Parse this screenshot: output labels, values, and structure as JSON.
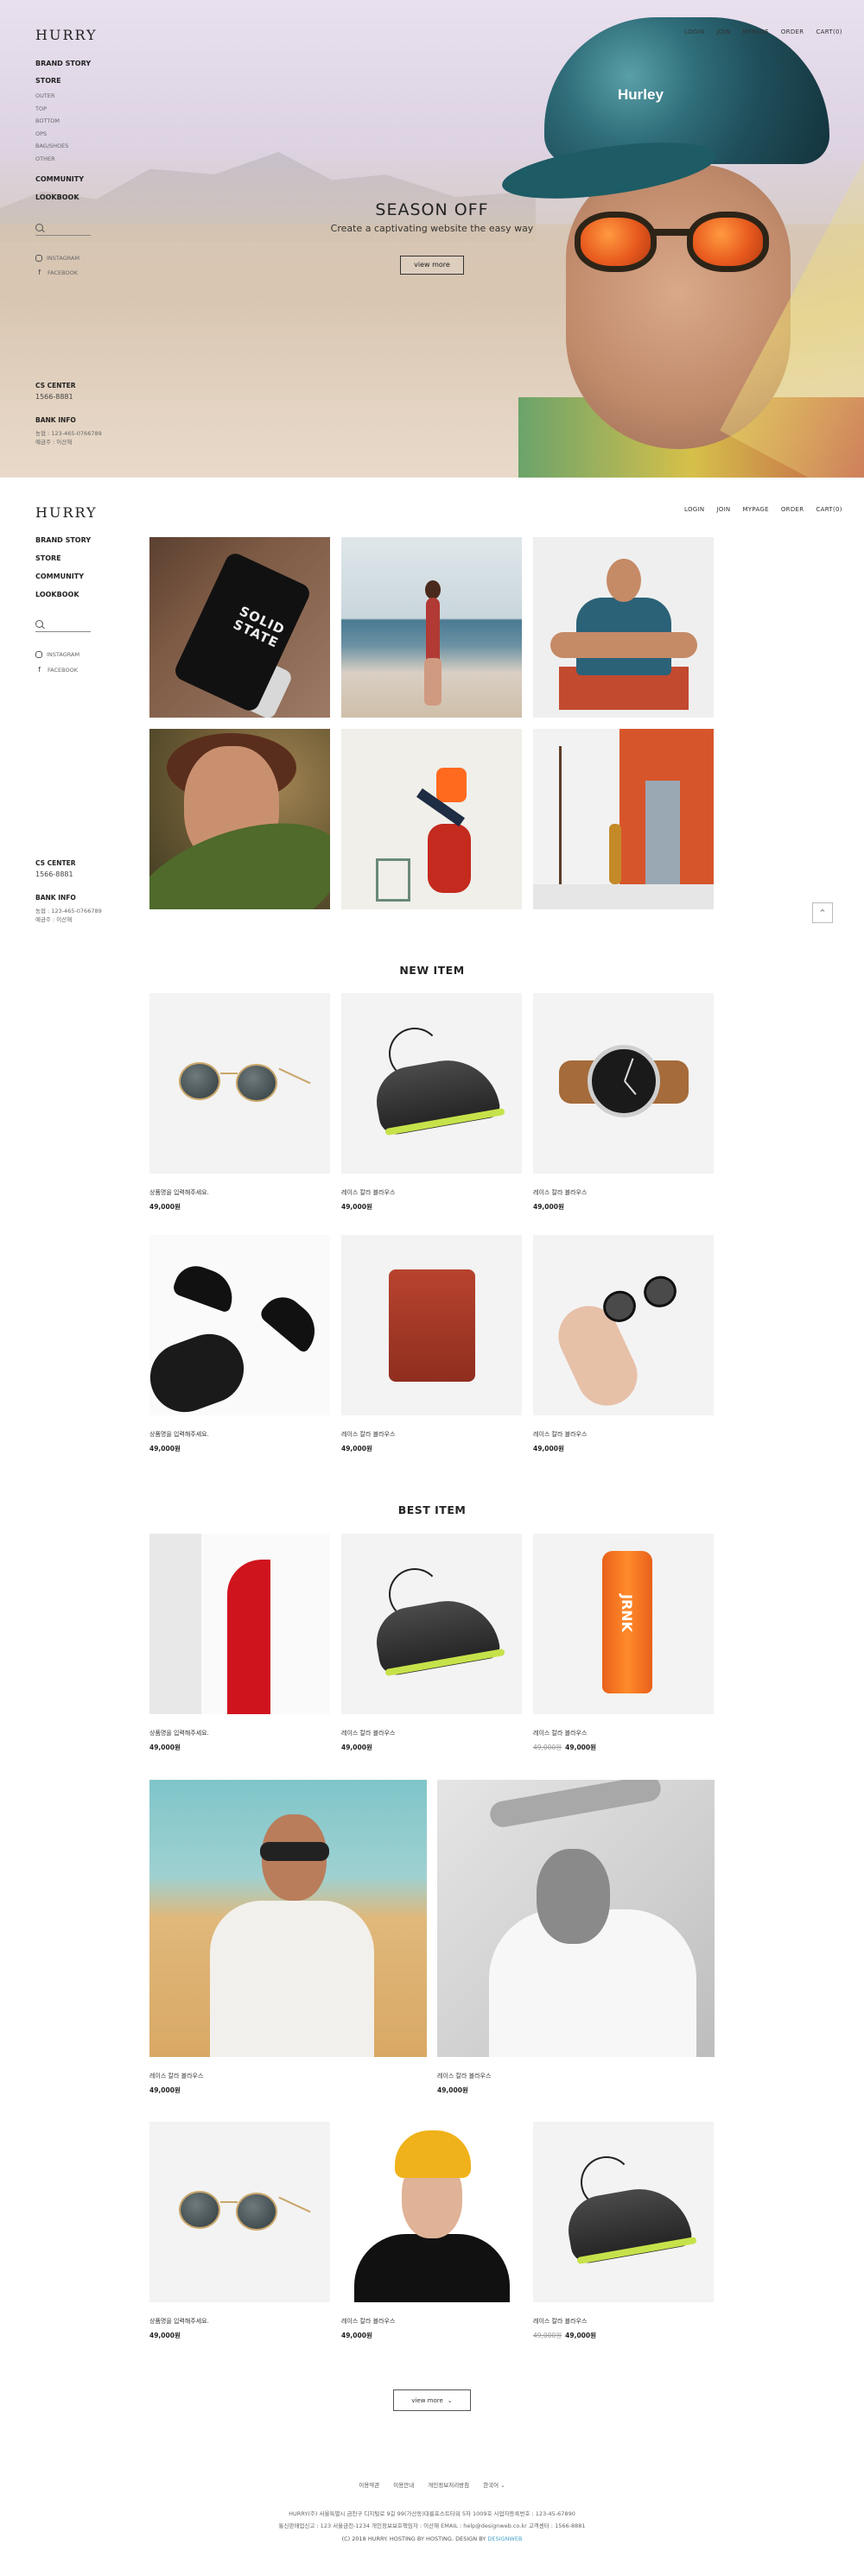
{
  "brand": "HURRY",
  "topnav": [
    "LOGIN",
    "JOIN",
    "MYPAGE",
    "ORDER",
    "CART(0)"
  ],
  "sidebar": {
    "main_items": [
      "BRAND STORY",
      "STORE",
      "COMMUNITY",
      "LOOKBOOK"
    ],
    "store_sub": [
      "OUTER",
      "TOP",
      "BOTTOM",
      "OPS",
      "BAG/SHOES",
      "OTHER"
    ],
    "social": [
      "INSTAGRAM",
      "FACEBOOK"
    ],
    "cs_title": "CS CENTER",
    "cs_phone": "1566-8881",
    "bank_title": "BANK INFO",
    "bank_lines": [
      "농협 : 123-465-0766789",
      "예금주 : 이산해"
    ]
  },
  "hero": {
    "title": "SEASON OFF",
    "subtitle": "Create a captivating website the easy way",
    "button": "view more",
    "hat_logo": "Hurley"
  },
  "gallery": {
    "phone_text": "SOLID STATE"
  },
  "new_item": {
    "title": "NEW ITEM",
    "products": [
      {
        "name": "상품명을 입력해주세요.",
        "price": "49,000원"
      },
      {
        "name": "레이스 칼라 블라우스",
        "price": "49,000원"
      },
      {
        "name": "레이스 칼라 블라우스",
        "price": "49,000원"
      },
      {
        "name": "상품명을 입력해주세요.",
        "price": "49,000원"
      },
      {
        "name": "레이스 칼라 블라우스",
        "price": "49,000원"
      },
      {
        "name": "레이스 칼라 블라우스",
        "price": "49,000원"
      }
    ]
  },
  "best_item": {
    "title": "BEST ITEM",
    "products": [
      {
        "name": "상품명을 입력해주세요.",
        "price": "49,000원"
      },
      {
        "name": "레이스 칼라 블라우스",
        "price": "49,000원"
      },
      {
        "name": "레이스 칼라 블라우스",
        "old_price": "49,000원",
        "price": "49,000원"
      }
    ],
    "large": [
      {
        "name": "레이스 칼라 블라우스",
        "price": "49,000원"
      },
      {
        "name": "레이스 칼라 블라우스",
        "price": "49,000원"
      }
    ],
    "products2": [
      {
        "name": "상품명을 입력해주세요.",
        "price": "49,000원"
      },
      {
        "name": "레이스 칼라 블라우스",
        "price": "49,000원"
      },
      {
        "name": "레이스 칼라 블라우스",
        "old_price": "49,000원",
        "price": "49,000원"
      }
    ],
    "jar_text": "JRNK"
  },
  "view_more": "view more",
  "footer": {
    "links": [
      "이용약관",
      "이용안내",
      "개인정보처리방침",
      "한국어"
    ],
    "info1": "HURRY(주)    서울특별시 금천구 디지털로 9길 99(가산동)대륭포스트타워 5차 1009호    사업자등록번호 : 123-45-67890",
    "info2": "통신판매업신고 : 123 서울금천-1234    개인정보보호책임자 : 이산해    EMAIL : help@designweb.co.kr    고객센터 : 1566-8881",
    "copyright": "(C) 2018 HURRY. HOSTING BY HOSTING. DESIGN BY",
    "designer": "DESIGNWEB"
  },
  "colors": {
    "accent": "#4aa3c8",
    "text": "#222222"
  }
}
